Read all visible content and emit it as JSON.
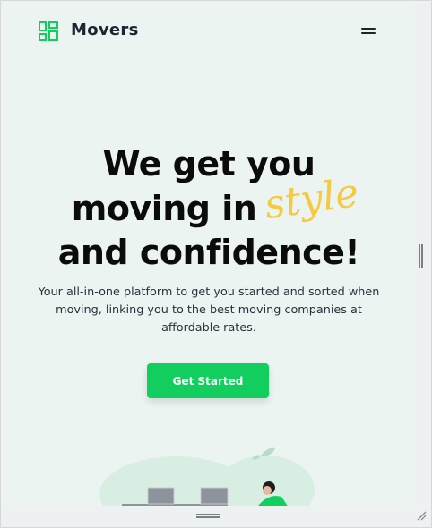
{
  "header": {
    "brand": "Movers",
    "logo_icon": "dashboard-grid-icon",
    "menu_icon": "hamburger-menu-icon"
  },
  "hero": {
    "line1": "We get you",
    "line2": "moving in",
    "accent_word": "style",
    "line3": "and confidence!",
    "subtitle": "Your all-in-one platform to get you started and sorted when moving, linking you to the best moving companies at affordable rates.",
    "cta_label": "Get Started"
  },
  "colors": {
    "brand_green": "#12ce5e",
    "accent_yellow": "#f5c940",
    "background": "#ebf4f1",
    "text_dark": "#0b0b0b"
  }
}
